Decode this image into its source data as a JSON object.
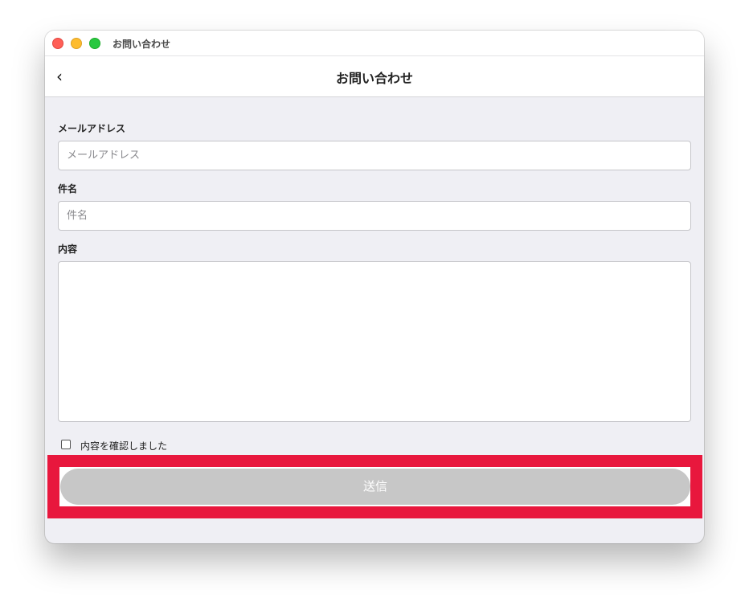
{
  "window": {
    "title": "お問い合わせ"
  },
  "navbar": {
    "back_icon": "chevron-left-icon",
    "back_glyph": "‹",
    "title": "お問い合わせ"
  },
  "form": {
    "email": {
      "label": "メールアドレス",
      "placeholder": "メールアドレス",
      "value": ""
    },
    "subject": {
      "label": "件名",
      "placeholder": "件名",
      "value": ""
    },
    "content": {
      "label": "内容",
      "value": ""
    },
    "confirm": {
      "label": "内容を確認しました",
      "checked": false
    },
    "submit": {
      "label": "送信",
      "enabled": false
    }
  },
  "colors": {
    "highlight": "#e8173d",
    "submit_disabled": "#c7c7c7",
    "background": "#efeff4"
  }
}
